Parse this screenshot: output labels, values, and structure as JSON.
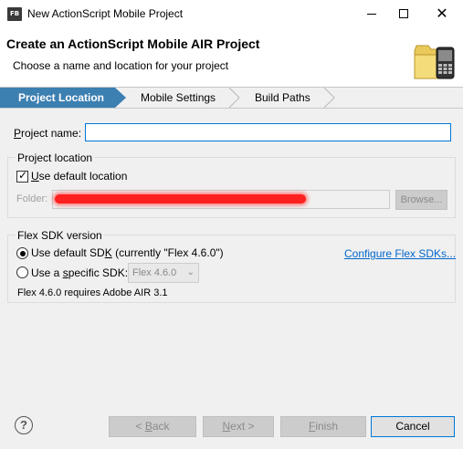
{
  "window": {
    "app_icon_text": "FB",
    "title": "New ActionScript Mobile Project",
    "controls": {
      "minimize": "",
      "maximize": "",
      "close": "✕"
    }
  },
  "header": {
    "title": "Create an ActionScript Mobile AIR Project",
    "subtitle": "Choose a name and location for your project",
    "icon": "folder-phone-icon"
  },
  "steps": [
    "Project Location",
    "Mobile Settings",
    "Build Paths"
  ],
  "project_name": {
    "label_prefix": "",
    "label_underlined": "P",
    "label_rest": "roject name:",
    "value": ""
  },
  "project_location": {
    "group_label": "Project location",
    "use_default": {
      "checked": true,
      "label_underlined": "U",
      "label_rest": "se default location"
    },
    "folder_label": "Folder:",
    "folder_value": "",
    "browse_label": "Browse..."
  },
  "flex_sdk": {
    "group_label": "Flex SDK version",
    "use_default": {
      "selected": true,
      "label_pre": "Use default SD",
      "label_underlined": "K",
      "label_post": " (currently \"Flex 4.6.0\")"
    },
    "configure_link": "Configure Flex SDKs...",
    "use_specific": {
      "selected": false,
      "label_pre": "Use a ",
      "label_underlined": "s",
      "label_post": "pecific SDK:"
    },
    "specific_value": "Flex 4.6.0",
    "requirement_note": "Flex 4.6.0 requires Adobe AIR 3.1"
  },
  "footer": {
    "help": "?",
    "back": {
      "prefix": "< ",
      "underlined": "B",
      "rest": "ack"
    },
    "next": {
      "underlined": "N",
      "rest": "ext >"
    },
    "finish": {
      "underlined": "F",
      "rest": "inish"
    },
    "cancel": "Cancel"
  },
  "colors": {
    "accent": "#0078d7",
    "active_step": "#3c7fb1",
    "link": "#0066cc",
    "redaction": "#ff2020"
  }
}
